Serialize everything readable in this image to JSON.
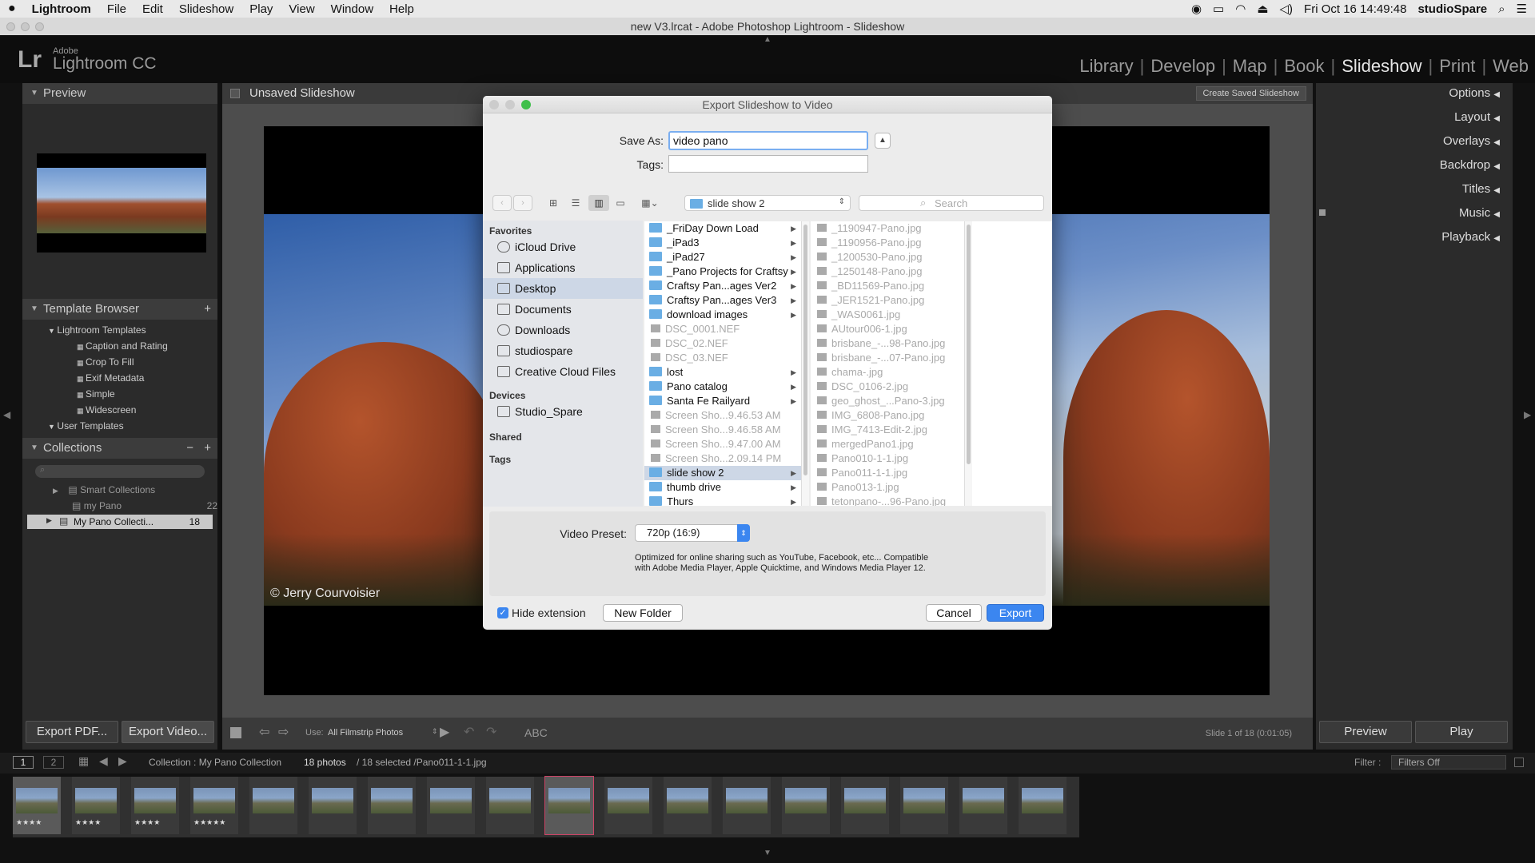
{
  "menubar": {
    "apple": "",
    "items": [
      "Lightroom",
      "File",
      "Edit",
      "Slideshow",
      "Play",
      "View",
      "Window",
      "Help"
    ],
    "status": {
      "clock": "Fri Oct 16  14:49:48",
      "user": "studioSpare"
    }
  },
  "window": {
    "title": "new V3.lrcat - Adobe Photoshop Lightroom - Slideshow"
  },
  "header": {
    "logo": "Lr",
    "brand_top": "Adobe",
    "brand_name": "Lightroom CC",
    "modules": [
      "Library",
      "Develop",
      "Map",
      "Book",
      "Slideshow",
      "Print",
      "Web"
    ],
    "active_module": "Slideshow"
  },
  "left_panel": {
    "preview_title": "Preview",
    "template_browser": {
      "title": "Template Browser",
      "add": "+",
      "group1": "Lightroom Templates",
      "items": [
        "Caption and Rating",
        "Crop To Fill",
        "Exif Metadata",
        "Simple",
        "Widescreen"
      ],
      "group2": "User Templates"
    },
    "collections": {
      "title": "Collections",
      "minus": "−",
      "plus": "+",
      "items": [
        {
          "name": "Smart Collections",
          "count": ""
        },
        {
          "name": "my Pano",
          "count": "22"
        },
        {
          "name": "My Pano Collecti...",
          "count": "18"
        }
      ]
    },
    "export_pdf": "Export PDF...",
    "export_video": "Export Video..."
  },
  "center": {
    "slideshow_title": "Unsaved Slideshow",
    "create_saved": "Create Saved Slideshow",
    "watermark": "© Jerry Courvoisier",
    "toolbar": {
      "use_label": "Use:",
      "use_value": "All Filmstrip Photos",
      "abc": "ABC",
      "slide_info": "Slide 1 of 18 (0:01:05)"
    }
  },
  "right_panel": {
    "sections": [
      "Options",
      "Layout",
      "Overlays",
      "Backdrop",
      "Titles",
      "Music",
      "Playback"
    ],
    "preview_btn": "Preview",
    "play_btn": "Play"
  },
  "dialog": {
    "title": "Export Slideshow to Video",
    "save_as_label": "Save As:",
    "save_as_value": "video pano",
    "tags_label": "Tags:",
    "tags_value": "",
    "location": "slide show 2",
    "search_placeholder": "Search",
    "favorites_label": "Favorites",
    "favorites": [
      "iCloud Drive",
      "Applications",
      "Desktop",
      "Documents",
      "Downloads",
      "studiospare",
      "Creative Cloud Files"
    ],
    "devices_label": "Devices",
    "devices": [
      "Studio_Spare"
    ],
    "shared_label": "Shared",
    "tags_section_label": "Tags",
    "column1": [
      {
        "name": "_FriDay Down Load",
        "type": "folder"
      },
      {
        "name": "_iPad3",
        "type": "folder"
      },
      {
        "name": "_iPad27",
        "type": "folder"
      },
      {
        "name": "_Pano Projects for Craftsy",
        "type": "folder"
      },
      {
        "name": "Craftsy Pan...ages Ver2",
        "type": "folder"
      },
      {
        "name": "Craftsy Pan...ages Ver3",
        "type": "folder"
      },
      {
        "name": "download images",
        "type": "folder"
      },
      {
        "name": "DSC_0001.NEF",
        "type": "file"
      },
      {
        "name": "DSC_02.NEF",
        "type": "file"
      },
      {
        "name": "DSC_03.NEF",
        "type": "file"
      },
      {
        "name": "lost",
        "type": "folder"
      },
      {
        "name": "Pano catalog",
        "type": "folder"
      },
      {
        "name": "Santa Fe Railyard",
        "type": "folder"
      },
      {
        "name": "Screen Sho...9.46.53 AM",
        "type": "file"
      },
      {
        "name": "Screen Sho...9.46.58 AM",
        "type": "file"
      },
      {
        "name": "Screen Sho...9.47.00 AM",
        "type": "file"
      },
      {
        "name": "Screen Sho...2.09.14 PM",
        "type": "file"
      },
      {
        "name": "slide show 2",
        "type": "folder"
      },
      {
        "name": "thumb drive",
        "type": "folder"
      },
      {
        "name": "Thurs",
        "type": "folder"
      }
    ],
    "column2": [
      "_1190947-Pano.jpg",
      "_1190956-Pano.jpg",
      "_1200530-Pano.jpg",
      "_1250148-Pano.jpg",
      "_BD11569-Pano.jpg",
      "_JER1521-Pano.jpg",
      "_WAS0061.jpg",
      "AUtour006-1.jpg",
      "brisbane_-...98-Pano.jpg",
      "brisbane_-...07-Pano.jpg",
      "chama-.jpg",
      "DSC_0106-2.jpg",
      "geo_ghost_...Pano-3.jpg",
      "IMG_6808-Pano.jpg",
      "IMG_7413-Edit-2.jpg",
      "mergedPano1.jpg",
      "Pano010-1-1.jpg",
      "Pano011-1-1.jpg",
      "Pano013-1.jpg",
      "tetonpano-...96-Pano.jpg"
    ],
    "video_preset_label": "Video Preset:",
    "video_preset_value": "720p (16:9)",
    "preset_desc_1": "Optimized for online sharing such as YouTube, Facebook, etc... Compatible",
    "preset_desc_2": "with Adobe Media Player, Apple Quicktime, and Windows Media Player 12.",
    "hide_extension": "Hide extension",
    "new_folder": "New Folder",
    "cancel": "Cancel",
    "export": "Export"
  },
  "filmstrip_bar": {
    "page1": "1",
    "page2": "2",
    "collection": "Collection : My Pano Collection",
    "count": "18 photos",
    "selection": "/ 18 selected /Pano011-1-1.jpg",
    "filter_label": "Filter :",
    "filter_value": "Filters Off"
  },
  "filmstrip": {
    "thumb_stars": [
      "★★★★",
      "★★★★",
      "★★★★",
      "★★★★★",
      "",
      "",
      "",
      "",
      "",
      "",
      "",
      "",
      "",
      "",
      "",
      "",
      "",
      ""
    ]
  },
  "colors": {
    "accent": "#2f7fe6",
    "panel": "#2a2a2a",
    "dialog": "#ececec"
  }
}
